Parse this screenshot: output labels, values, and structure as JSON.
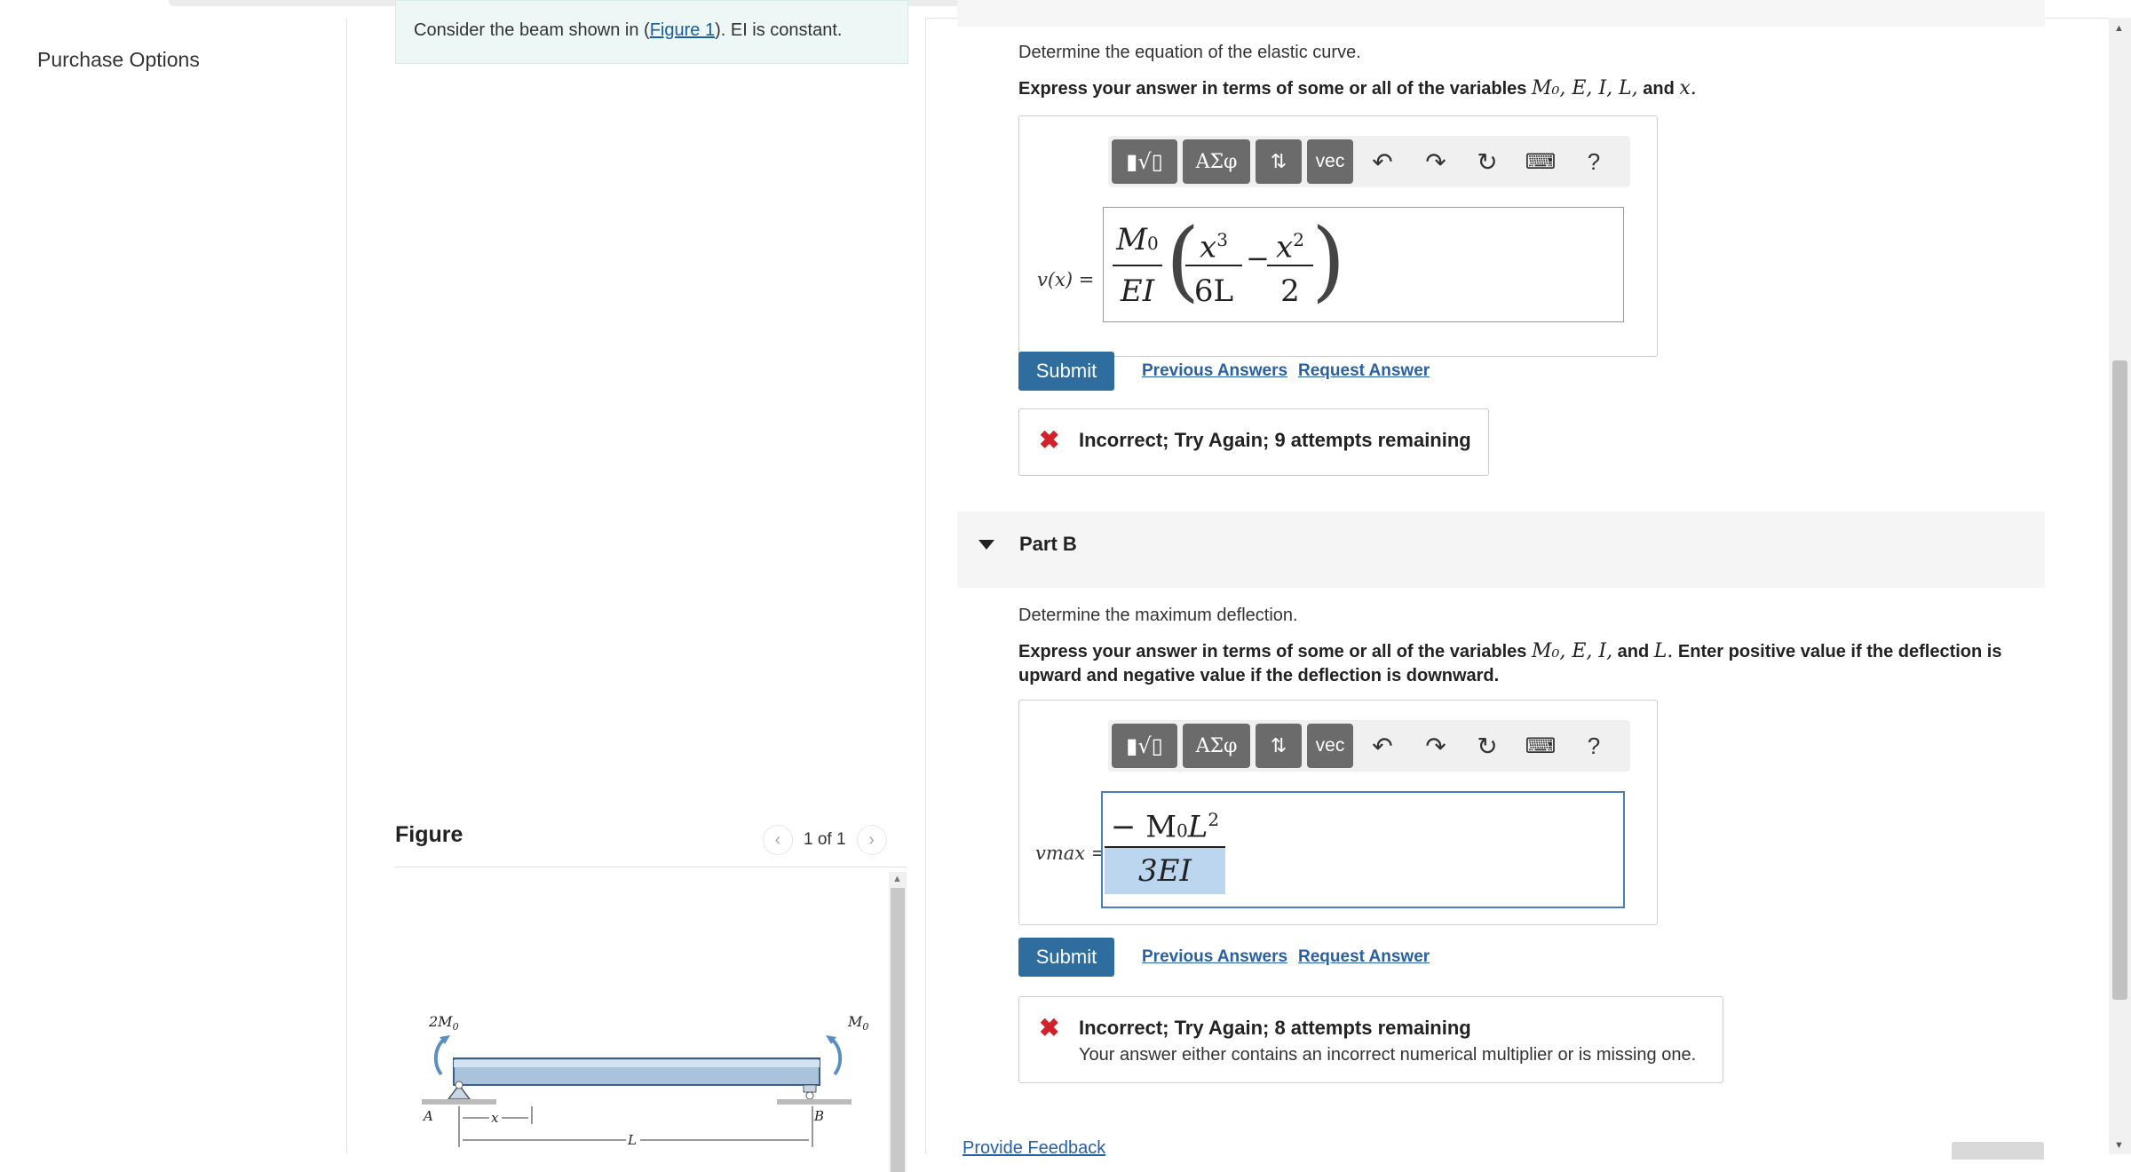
{
  "sidebar": {
    "purchase_options": "Purchase Options"
  },
  "problem": {
    "text_before": "Consider the beam shown in (",
    "figure_link": "Figure 1",
    "text_after": "). EI is constant."
  },
  "figure": {
    "title": "Figure",
    "pager": "1 of 1",
    "prev_icon": "chevron-left-icon",
    "next_icon": "chevron-right-icon",
    "labels": {
      "left_moment": "2M",
      "left_moment_sub": "0",
      "right_moment": "M",
      "right_moment_sub": "0",
      "a": "A",
      "b": "B",
      "x": "x",
      "l": "L"
    }
  },
  "toolbar": {
    "templates": "▮√▯",
    "greek": "ΑΣφ",
    "arrows": "⇅",
    "vec": "vec",
    "help": "?"
  },
  "part_a": {
    "prompt": "Determine the equation of the elastic curve.",
    "instr_prefix": "Express your answer in terms of some or all of the variables",
    "instr_vars": "M₀, E, I, L,",
    "instr_and": "and",
    "instr_last": "x.",
    "label": "v(x) =",
    "answer": {
      "coef_num": "M",
      "coef_num_sub": "0",
      "coef_den": "EI",
      "t1_num": "x",
      "t1_num_sup": "3",
      "t1_den": "6L",
      "minus": "−",
      "t2_num": "x",
      "t2_num_sup": "2",
      "t2_den": "2"
    },
    "submit": "Submit",
    "previous_answers": "Previous Answers",
    "request_answer": "Request Answer",
    "feedback": "Incorrect; Try Again; 9 attempts remaining"
  },
  "part_b": {
    "header": "Part B",
    "prompt": "Determine the maximum deflection.",
    "instr_prefix": "Express your answer in terms of some or all of the variables",
    "instr_vars": "M₀, E, I,",
    "instr_and": "and",
    "instr_last": "L.",
    "instr_suffix": "Enter positive value if the deflection is upward and negative value if the deflection is downward.",
    "label": "vmax =",
    "answer": {
      "num": "− M",
      "num_sub": "0",
      "num_l": "L",
      "num_sup": "2",
      "den": "3EI"
    },
    "submit": "Submit",
    "previous_answers": "Previous Answers",
    "request_answer": "Request Answer",
    "feedback": "Incorrect; Try Again; 8 attempts remaining",
    "feedback_detail": "Your answer either contains an incorrect numerical multiplier or is missing one."
  },
  "footer": {
    "provide_feedback": "Provide Feedback"
  },
  "colors": {
    "submit": "#2e6d9e",
    "link": "#2860a6",
    "error": "#d4202a",
    "toolbar_button": "#6b6b6b"
  }
}
